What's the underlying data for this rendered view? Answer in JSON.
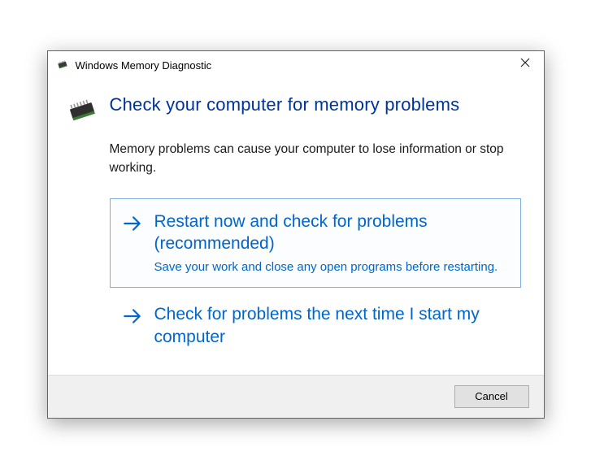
{
  "window": {
    "title": "Windows Memory Diagnostic"
  },
  "heading": "Check your computer for memory problems",
  "description": "Memory problems can cause your computer to lose information or stop working.",
  "options": {
    "restart_now": {
      "title": "Restart now and check for problems (recommended)",
      "subtitle": "Save your work and close any open programs before restarting."
    },
    "next_start": {
      "title": "Check for problems the next time I start my computer"
    }
  },
  "buttons": {
    "cancel": "Cancel"
  },
  "colors": {
    "accent": "#0066cc",
    "heading": "#003399"
  }
}
